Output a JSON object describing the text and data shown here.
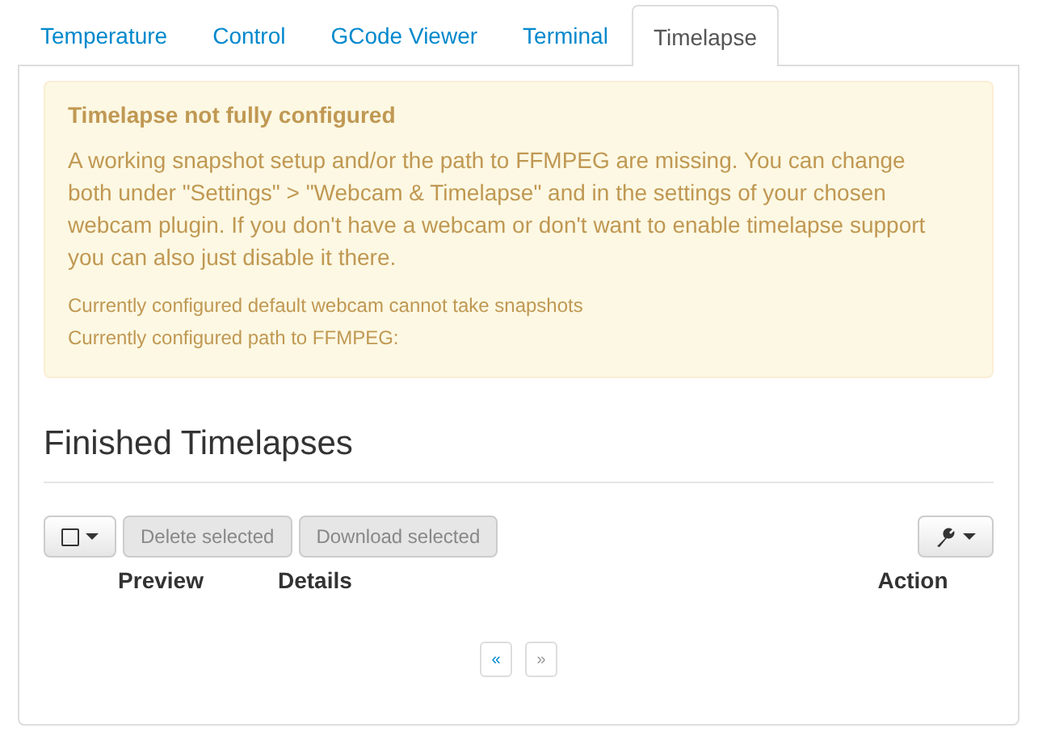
{
  "tabs": [
    {
      "label": "Temperature",
      "selected": false
    },
    {
      "label": "Control",
      "selected": false
    },
    {
      "label": "GCode Viewer",
      "selected": false
    },
    {
      "label": "Terminal",
      "selected": false
    },
    {
      "label": "Timelapse",
      "selected": true
    }
  ],
  "alert": {
    "title": "Timelapse not fully configured",
    "message": "A working snapshot setup and/or the path to FFMPEG are missing. You can change both under \"Settings\" > \"Webcam & Timelapse\" and in the settings of your chosen webcam plugin. If you don't have a webcam or don't want to enable timelapse support you can also just disable it there.",
    "notes": [
      "Currently configured default webcam cannot take snapshots",
      "Currently configured path to FFMPEG:"
    ]
  },
  "section": {
    "title": "Finished Timelapses"
  },
  "toolbar": {
    "select_all_checked": false,
    "buttons": [
      {
        "label": "Delete selected",
        "disabled": true
      },
      {
        "label": "Download selected",
        "disabled": true
      }
    ]
  },
  "table": {
    "columns": [
      "Preview",
      "Details",
      "Action"
    ]
  },
  "pager": [
    {
      "label": "«",
      "disabled": false
    },
    {
      "label": "»",
      "disabled": true
    }
  ]
}
